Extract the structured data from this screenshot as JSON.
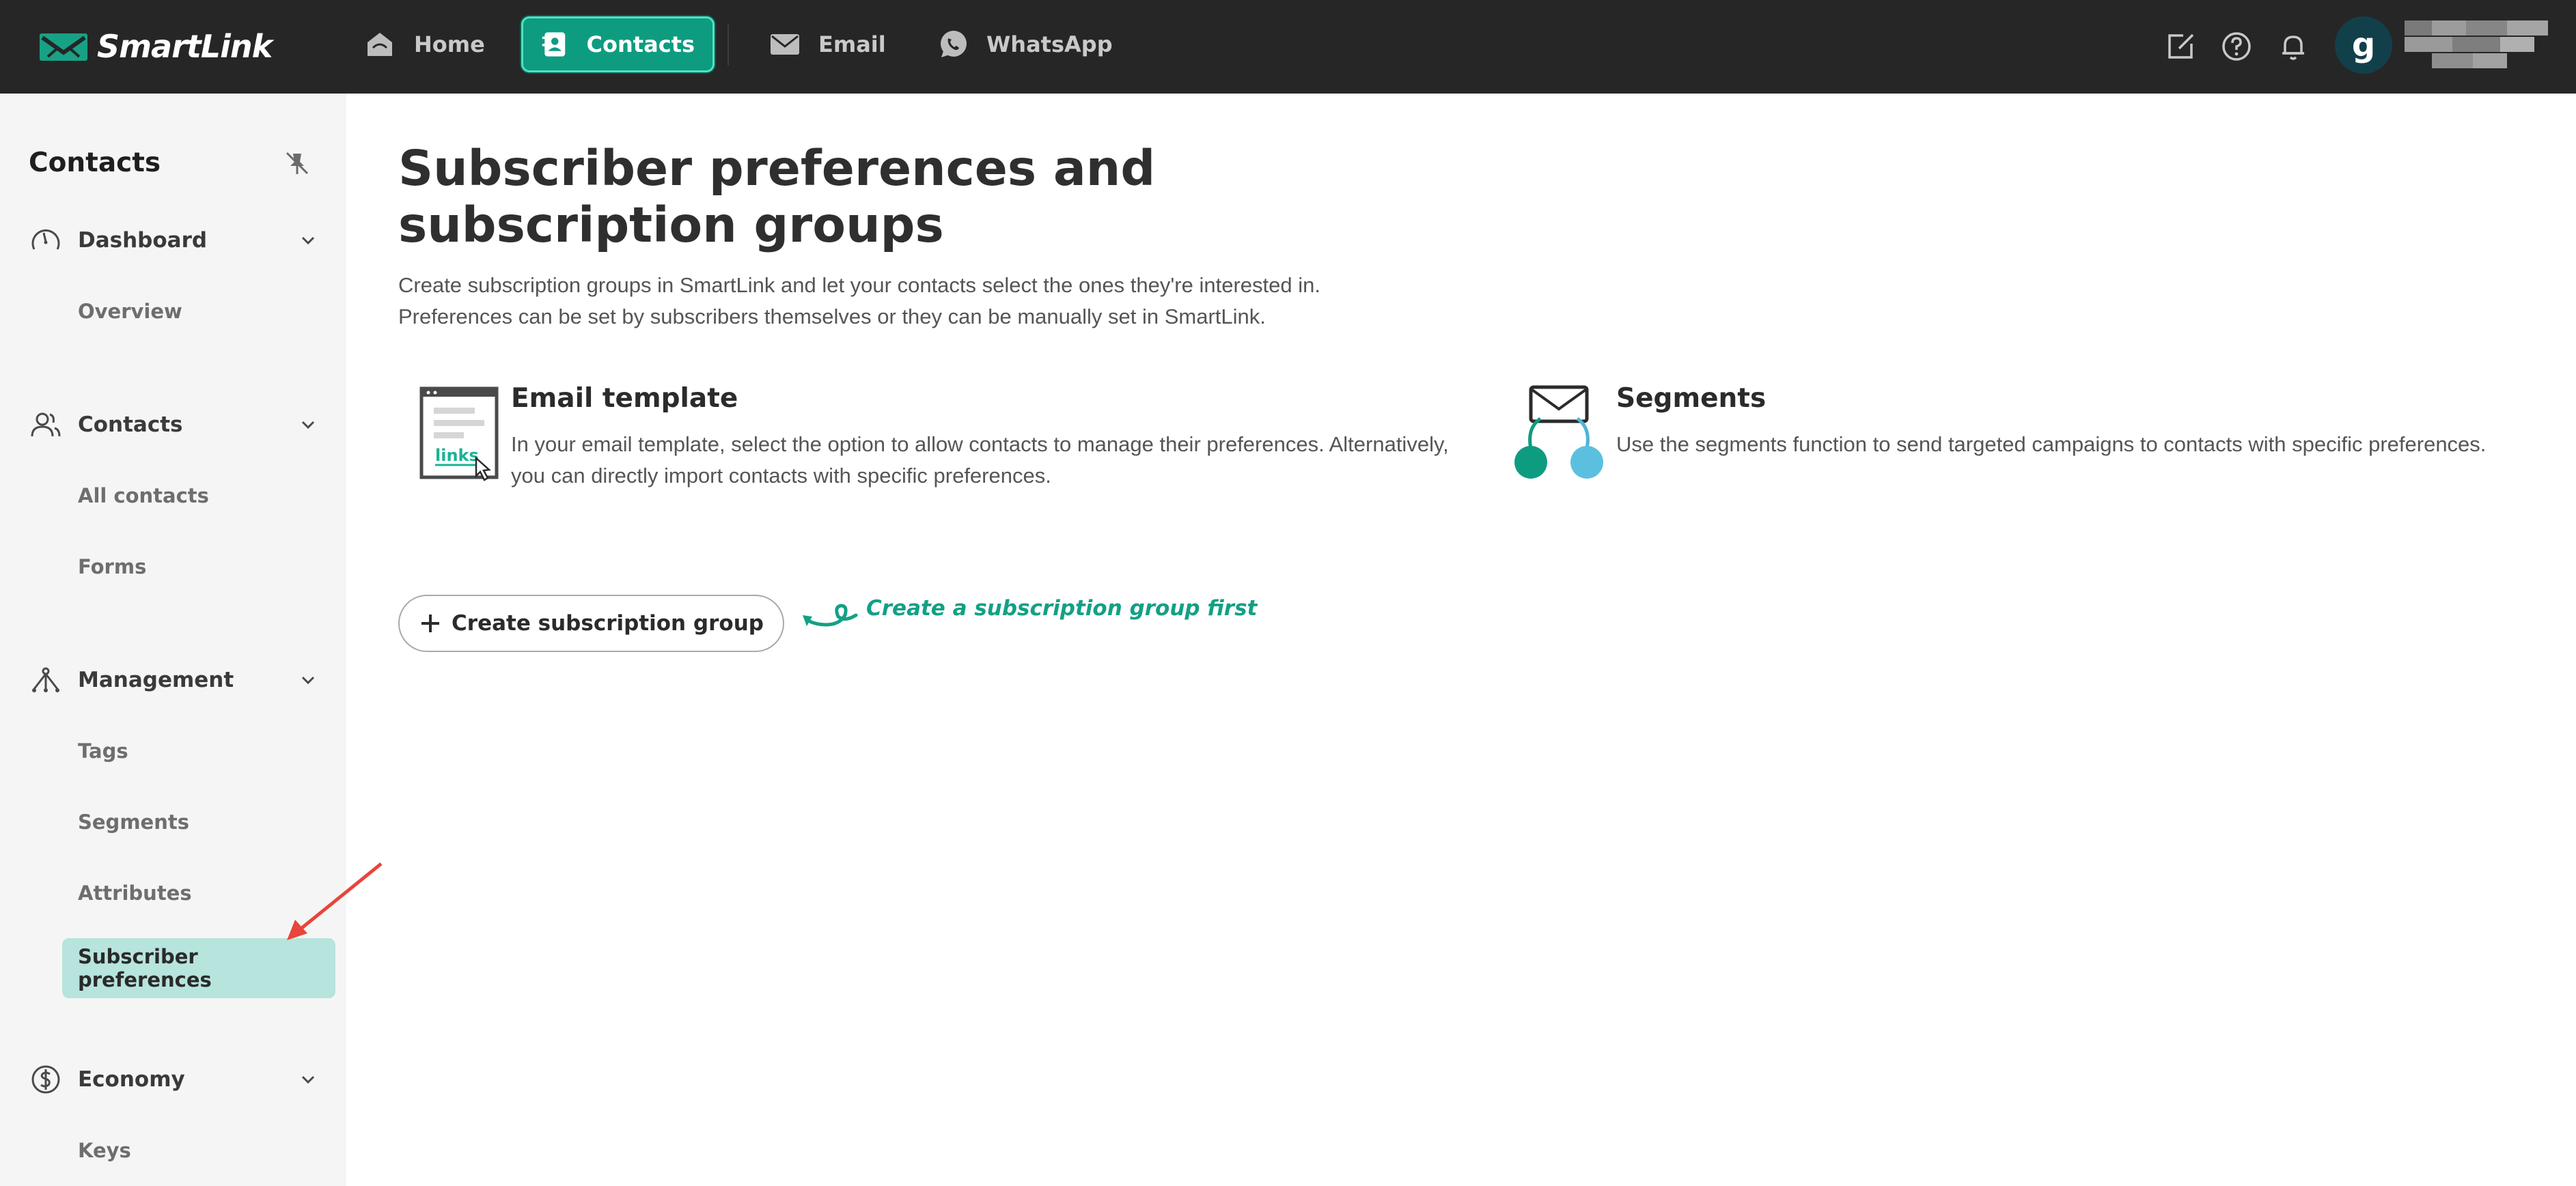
{
  "app": {
    "brand": "SmartLink",
    "avatar_initial": "g",
    "accent_color": "#0e9c80"
  },
  "topnav": {
    "items": [
      {
        "label": "Home",
        "icon": "home-icon"
      },
      {
        "label": "Contacts",
        "icon": "contacts-book-icon",
        "active": true
      },
      {
        "label": "Email",
        "icon": "envelope-icon"
      },
      {
        "label": "WhatsApp",
        "icon": "whatsapp-icon"
      }
    ],
    "right_icons": [
      "edit-icon",
      "help-icon",
      "bell-icon"
    ]
  },
  "sidebar": {
    "title": "Contacts",
    "sections": [
      {
        "label": "Dashboard",
        "icon": "gauge-icon",
        "items": [
          "Overview"
        ]
      },
      {
        "label": "Contacts",
        "icon": "users-icon",
        "items": [
          "All contacts",
          "Forms"
        ]
      },
      {
        "label": "Management",
        "icon": "hierarchy-icon",
        "items": [
          "Tags",
          "Segments",
          "Attributes",
          "Subscriber preferences"
        ]
      },
      {
        "label": "Economy",
        "icon": "dollar-circle-icon",
        "items": [
          "Keys"
        ]
      }
    ],
    "active_item": "Subscriber preferences"
  },
  "main": {
    "title": "Subscriber preferences and subscription groups",
    "description_lines": [
      "Create subscription groups in SmartLink and let your contacts select the ones they're interested in.",
      "Preferences can be set by subscribers themselves or they can be manually set in SmartLink."
    ],
    "features": [
      {
        "title": "Email template",
        "icon": "email-template-icon",
        "icon_text": "links",
        "text_lines": [
          "In your email template, select the option to allow contacts to manage their preferences. Alternatively,",
          "you can directly import contacts with specific preferences."
        ]
      },
      {
        "title": "Segments",
        "icon": "segments-icon",
        "text_lines": [
          "Use the segments function to send targeted campaigns to contacts with specific preferences."
        ]
      }
    ],
    "create_button_label": "Create subscription group",
    "hint": "Create a subscription group first"
  }
}
